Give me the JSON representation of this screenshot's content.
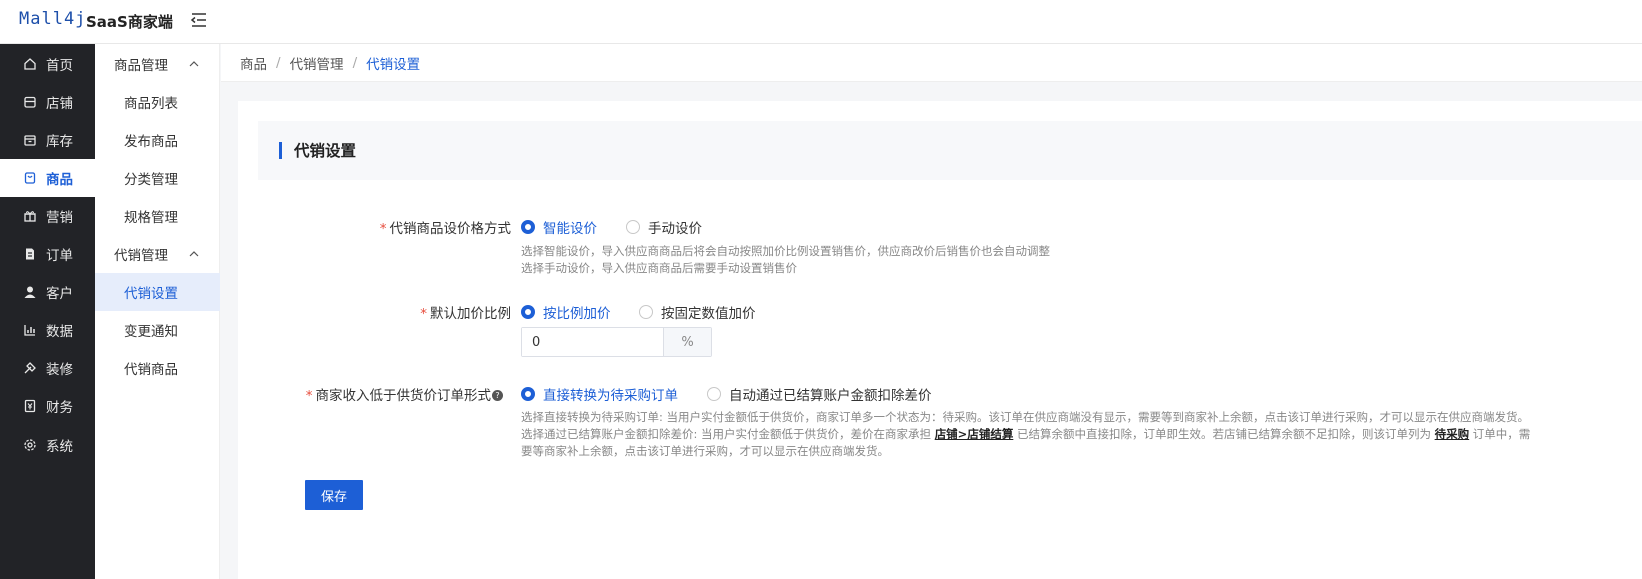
{
  "header": {
    "logo_text": "Mall4j",
    "app_title": "SaaS商家端"
  },
  "nav_primary": [
    {
      "label": "首页",
      "icon": "home-icon"
    },
    {
      "label": "店铺",
      "icon": "store-icon"
    },
    {
      "label": "库存",
      "icon": "inventory-icon"
    },
    {
      "label": "商品",
      "icon": "product-icon",
      "active": true
    },
    {
      "label": "营销",
      "icon": "gift-icon"
    },
    {
      "label": "订单",
      "icon": "order-icon"
    },
    {
      "label": "客户",
      "icon": "user-icon"
    },
    {
      "label": "数据",
      "icon": "chart-icon"
    },
    {
      "label": "装修",
      "icon": "decorate-icon"
    },
    {
      "label": "财务",
      "icon": "finance-icon"
    },
    {
      "label": "系统",
      "icon": "gear-icon"
    }
  ],
  "nav_secondary": {
    "group1": {
      "label": "商品管理",
      "items": [
        "商品列表",
        "发布商品",
        "分类管理",
        "规格管理"
      ]
    },
    "group2": {
      "label": "代销管理",
      "items": [
        "代销设置",
        "变更通知",
        "代销商品"
      ],
      "active_index": 0
    }
  },
  "breadcrumb": [
    "商品",
    "代销管理",
    "代销设置"
  ],
  "section_title": "代销设置",
  "form": {
    "pricing_mode": {
      "label": "代销商品设价格方式",
      "options": [
        "智能设价",
        "手动设价"
      ],
      "selected": 0,
      "hint_lines": [
        "选择智能设价，导入供应商商品后将会自动按照加价比例设置销售价，供应商改价后销售价也会自动调整",
        "选择手动设价，导入供应商商品后需要手动设置销售价"
      ]
    },
    "markup": {
      "label": "默认加价比例",
      "options": [
        "按比例加价",
        "按固定数值加价"
      ],
      "selected": 0,
      "value": "0",
      "suffix": "%"
    },
    "low_income": {
      "label": "商家收入低于供货价订单形式",
      "options": [
        "直接转换为待采购订单",
        "自动通过已结算账户金额扣除差价"
      ],
      "selected": 0,
      "hint_line1": "选择直接转换为待采购订单: 当用户实付金额低于供货价，商家订单多一个状态为：待采购。该订单在供应商端没有显示，需要等到商家补上余额，点击该订单进行采购，才可以显示在供应商端发货。",
      "hint_line2_a": "选择通过已结算账户金额扣除差价: 当用户实付金额低于供货价，差价在商家承担",
      "hint_line2_link1": "店铺>店铺结算",
      "hint_line2_b": "已结算余额中直接扣除，订单即生效。若店铺已结算余额不足扣除，则该订单列为",
      "hint_line2_link2": "待采购",
      "hint_line2_c": "订单中，需",
      "hint_line3": "要等商家补上余额，点击该订单进行采购，才可以显示在供应商端发货。"
    }
  },
  "save_label": "保存",
  "colors": {
    "accent": "#1d5fd6",
    "sidebar_bg": "#222327",
    "required": "#e74c3c"
  }
}
